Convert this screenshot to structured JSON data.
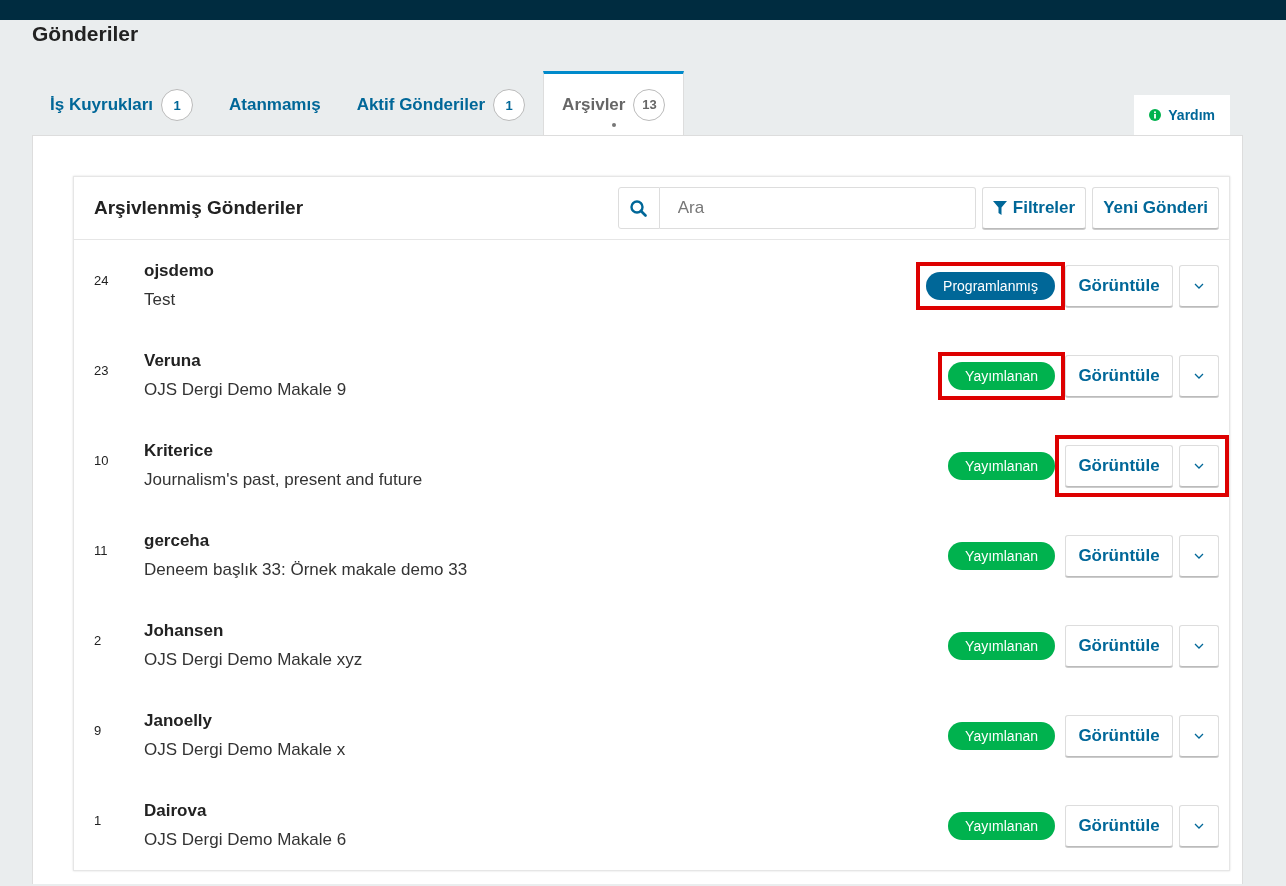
{
  "page_title": "Gönderiler",
  "tabs": [
    {
      "label": "İş Kuyrukları",
      "count": "1",
      "selected": false
    },
    {
      "label": "Atanmamış",
      "selected": false
    },
    {
      "label": "Aktif Gönderiler",
      "count": "1",
      "selected": false
    },
    {
      "label": "Arşivler",
      "count": "13",
      "selected": true
    }
  ],
  "help_button": "Yardım",
  "list": {
    "title": "Arşivlenmiş Gönderiler",
    "search": {
      "placeholder": "Ara"
    },
    "filter_button": "Filtreler",
    "new_button": "Yeni Gönderi",
    "rows": [
      {
        "id": "24",
        "author": "ojsdemo",
        "title": "Test",
        "status": "Programlanmış",
        "kind": "scheduled",
        "view_button": "Görüntüle",
        "status_highlighted": true,
        "actions_highlighted": false
      },
      {
        "id": "23",
        "author": "Veruna",
        "title": "OJS Dergi Demo Makale 9",
        "status": "Yayımlanan",
        "kind": "published",
        "view_button": "Görüntüle",
        "status_highlighted": true,
        "actions_highlighted": false
      },
      {
        "id": "10",
        "author": "Kriterice",
        "title": "Journalism's past, present and future",
        "status": "Yayımlanan",
        "kind": "published",
        "view_button": "Görüntüle",
        "status_highlighted": false,
        "actions_highlighted": true
      },
      {
        "id": "11",
        "author": "gerceha",
        "title": "Deneem başlık 33: Örnek makale demo 33",
        "status": "Yayımlanan",
        "kind": "published",
        "view_button": "Görüntüle",
        "status_highlighted": false,
        "actions_highlighted": false
      },
      {
        "id": "2",
        "author": "Johansen",
        "title": "OJS Dergi Demo Makale xyz",
        "status": "Yayımlanan",
        "kind": "published",
        "view_button": "Görüntüle",
        "status_highlighted": false,
        "actions_highlighted": false
      },
      {
        "id": "9",
        "author": "Janoelly",
        "title": "OJS Dergi Demo Makale x",
        "status": "Yayımlanan",
        "kind": "published",
        "view_button": "Görüntüle",
        "status_highlighted": false,
        "actions_highlighted": false
      },
      {
        "id": "1",
        "author": "Dairova",
        "title": "OJS Dergi Demo Makale 6",
        "status": "Yayımlanan",
        "kind": "published",
        "view_button": "Görüntüle",
        "status_highlighted": false,
        "actions_highlighted": false
      }
    ]
  }
}
